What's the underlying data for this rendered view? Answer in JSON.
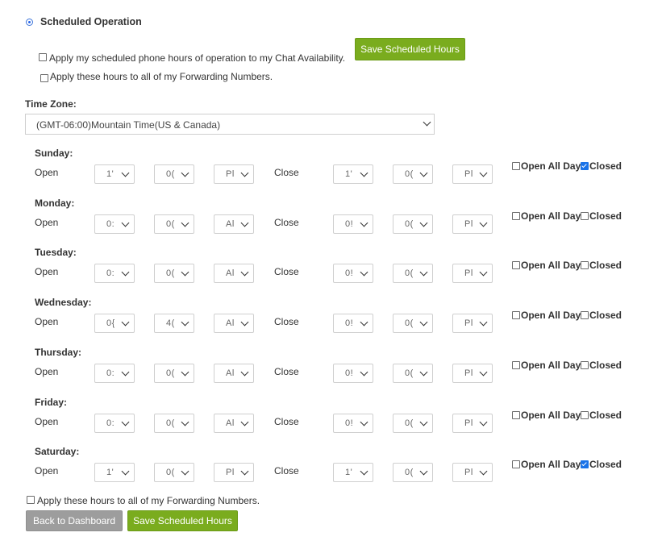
{
  "scheduled_operation": {
    "label": "Scheduled Operation",
    "selected": true
  },
  "options": {
    "apply_chat": "Apply my scheduled phone hours of operation to my Chat Availability.",
    "apply_forwarding": "Apply these hours to all of my Forwarding Numbers."
  },
  "save_label": "Save Scheduled Hours",
  "timezone": {
    "label": "Time Zone:",
    "value": "(GMT-06:00)Mountain Time(US & Canada)"
  },
  "labels": {
    "open": "Open",
    "close": "Close",
    "open_all_day": "Open All Day",
    "closed": "Closed"
  },
  "days": [
    {
      "name": "Sunday:",
      "open": [
        "1'",
        "0(",
        "Pl"
      ],
      "close": [
        "1'",
        "0(",
        "Pl"
      ],
      "open_all_day": false,
      "closed": true
    },
    {
      "name": "Monday:",
      "open": [
        "0:",
        "0(",
        "Al"
      ],
      "close": [
        "0!",
        "0(",
        "Pl"
      ],
      "open_all_day": false,
      "closed": false
    },
    {
      "name": "Tuesday:",
      "open": [
        "0:",
        "0(",
        "Al"
      ],
      "close": [
        "0!",
        "0(",
        "Pl"
      ],
      "open_all_day": false,
      "closed": false
    },
    {
      "name": "Wednesday:",
      "open": [
        "0{",
        "4(",
        "Al"
      ],
      "close": [
        "0!",
        "0(",
        "Pl"
      ],
      "open_all_day": false,
      "closed": false
    },
    {
      "name": "Thursday:",
      "open": [
        "0:",
        "0(",
        "Al"
      ],
      "close": [
        "0!",
        "0(",
        "Pl"
      ],
      "open_all_day": false,
      "closed": false
    },
    {
      "name": "Friday:",
      "open": [
        "0:",
        "0(",
        "Al"
      ],
      "close": [
        "0!",
        "0(",
        "Pl"
      ],
      "open_all_day": false,
      "closed": false
    },
    {
      "name": "Saturday:",
      "open": [
        "1'",
        "0(",
        "Pl"
      ],
      "close": [
        "1'",
        "0(",
        "Pl"
      ],
      "open_all_day": false,
      "closed": true
    }
  ],
  "footer": {
    "apply_forwarding": "Apply these hours to all of my Forwarding Numbers.",
    "back_label": "Back to Dashboard",
    "save_label": "Save Scheduled Hours"
  }
}
